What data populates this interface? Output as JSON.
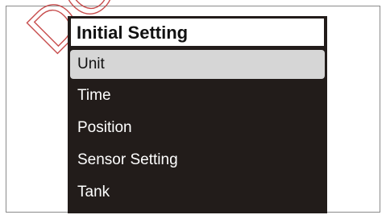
{
  "watermark": "DO",
  "screen": {
    "title": "Initial Setting",
    "menu": [
      {
        "label": "Unit",
        "selected": true
      },
      {
        "label": "Time",
        "selected": false
      },
      {
        "label": "Position",
        "selected": false
      },
      {
        "label": "Sensor Setting",
        "selected": false
      },
      {
        "label": "Tank",
        "selected": false
      }
    ]
  },
  "colors": {
    "screen_background": "#221c1a",
    "selected_background": "#d6d6d6",
    "menu_text": "#ffffff",
    "watermark": "#c23a3a"
  }
}
